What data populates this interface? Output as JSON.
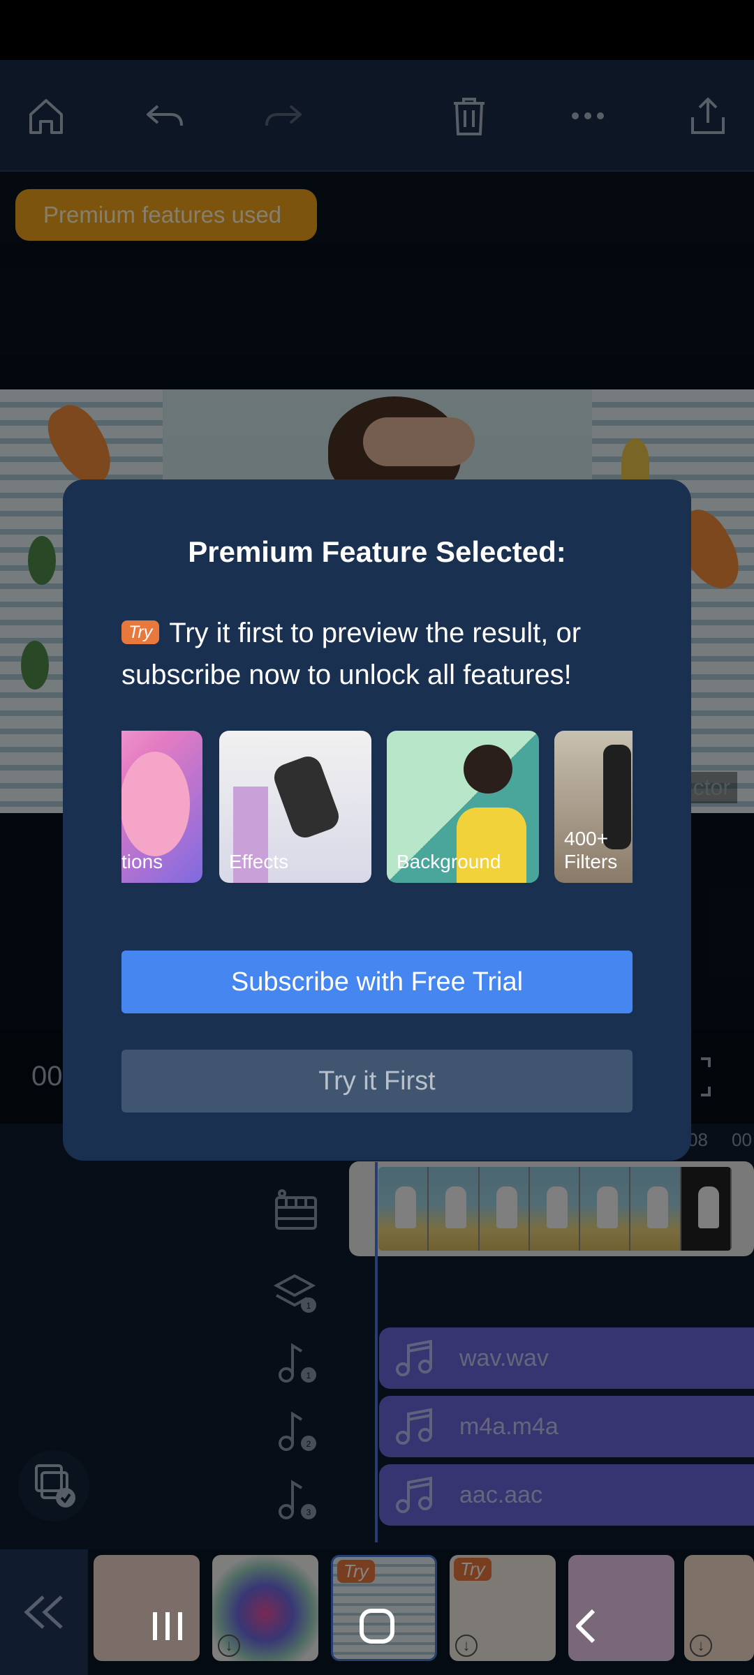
{
  "toolbar": {
    "icons": [
      "home-icon",
      "undo-icon",
      "redo-icon",
      "delete-icon",
      "more-icon",
      "share-icon"
    ]
  },
  "premium_badge": "Premium features used",
  "preview": {
    "watermark_text": "ctor"
  },
  "timeline": {
    "time_text": "00",
    "ruler": [
      "08",
      "00"
    ],
    "audio_clips": [
      {
        "name": "wav.wav"
      },
      {
        "name": "m4a.m4a"
      },
      {
        "name": "aac.aac"
      }
    ],
    "track_badges": [
      "1",
      "1",
      "2",
      "3"
    ]
  },
  "bottom_strip": {
    "try_label": "Try"
  },
  "modal": {
    "title": "Premium Feature Selected:",
    "try_badge": "Try",
    "message": "Try it first to preview the result, or subscribe now to unlock all features!",
    "cards": [
      {
        "label": "tions"
      },
      {
        "label": "Effects"
      },
      {
        "label": "Background"
      },
      {
        "label": "400+ Filters"
      }
    ],
    "subscribe_label": "Subscribe with Free Trial",
    "try_first_label": "Try it First"
  },
  "colors": {
    "accent": "#4586f0",
    "modal_bg": "#1a3050",
    "premium_badge": "#f0a21c",
    "try_tag": "#e8783c",
    "audio_clip": "#6a67d8"
  }
}
